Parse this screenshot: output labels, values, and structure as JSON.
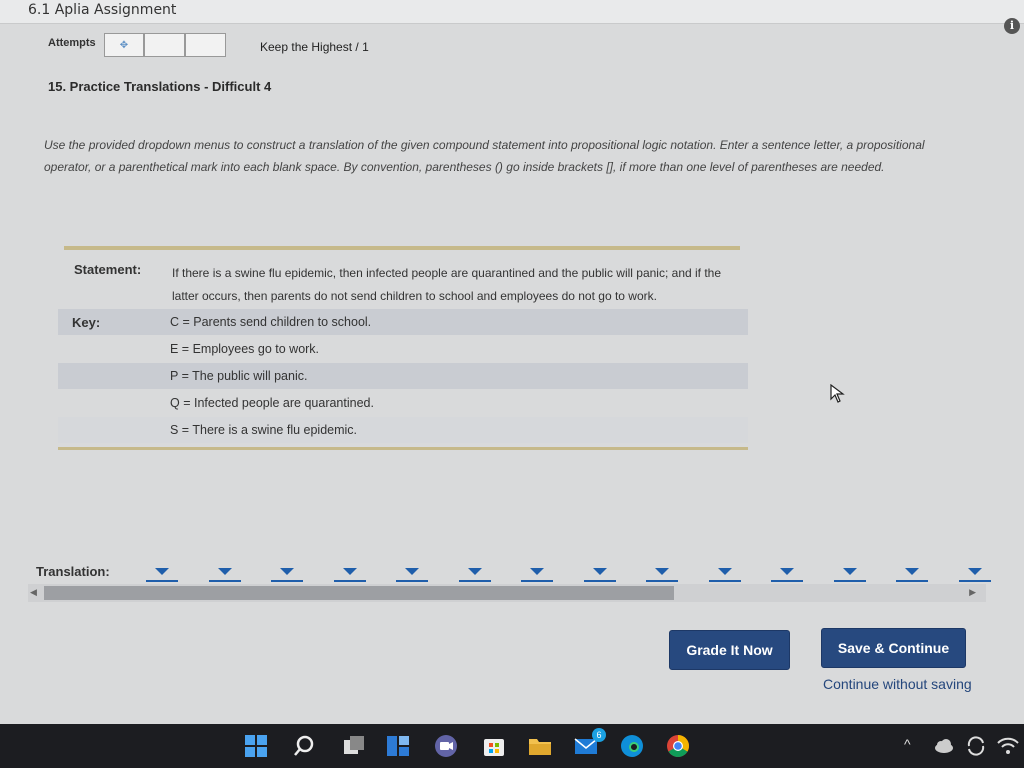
{
  "header": {
    "title": "6.1 Aplia Assignment"
  },
  "attempts": {
    "label": "Attempts",
    "policy": "Keep the Highest / 1"
  },
  "question": {
    "title": "15. Practice Translations - Difficult 4"
  },
  "instructions": "Use the provided dropdown menus to construct a translation of the given compound statement into propositional logic notation. Enter a sentence letter, a propositional operator, or a parenthetical mark into each blank space. By convention, parentheses () go inside brackets [], if more than one level of parentheses are needed.",
  "statement": {
    "label": "Statement:",
    "text": "If there is a swine flu epidemic, then infected people are quarantined and the public will panic; and if the latter occurs, then parents do not send children to school and employees do not go to work."
  },
  "key": {
    "label": "Key:",
    "items": [
      "C = Parents send children to school.",
      "E = Employees go to work.",
      "P = The public will panic.",
      "Q = Infected people are quarantined.",
      "S = There is a swine flu epidemic."
    ]
  },
  "translation": {
    "label": "Translation:",
    "dropdown_count": 14
  },
  "buttons": {
    "grade": "Grade It Now",
    "save": "Save & Continue",
    "continue": "Continue without saving"
  },
  "taskbar": {
    "mail_badge": "6"
  },
  "colors": {
    "accent": "#27497f",
    "dropdown": "#1f5eab",
    "rule": "#c6b98a"
  }
}
